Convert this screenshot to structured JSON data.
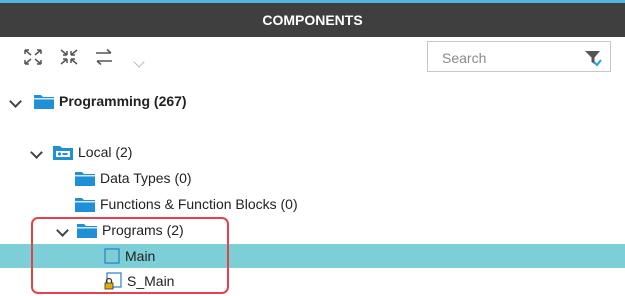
{
  "panel": {
    "title": "COMPONENTS"
  },
  "toolbar": {
    "expand_icon": "expand-all-icon",
    "collapse_icon": "collapse-all-icon",
    "sync_icon": "sync-arrows-icon"
  },
  "search": {
    "placeholder": "Search",
    "value": ""
  },
  "tree": {
    "root": {
      "label": "Programming (267)"
    },
    "local": {
      "label": "Local (2)"
    },
    "data_types": {
      "label": "Data Types (0)"
    },
    "functions": {
      "label": "Functions & Function Blocks (0)"
    },
    "programs": {
      "label": "Programs (2)"
    },
    "main": {
      "label": "Main"
    },
    "s_main": {
      "label": "S_Main"
    }
  },
  "colors": {
    "header_bg": "#3f3f3f",
    "header_accent": "#53b6e0",
    "selection": "#7ccfd6",
    "folder": "#1f8fd6",
    "highlight_border": "#e0434b"
  }
}
